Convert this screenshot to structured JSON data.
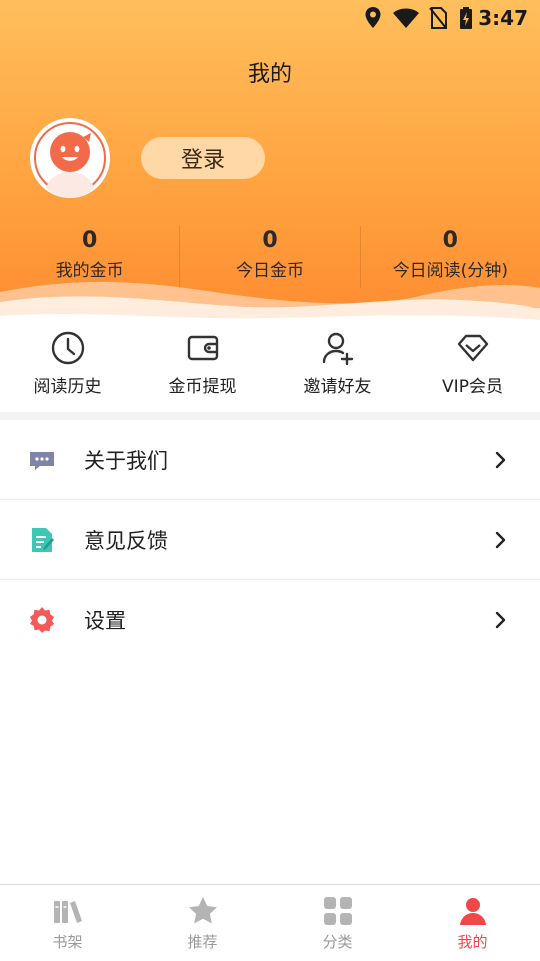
{
  "status": {
    "time": "3:47"
  },
  "page": {
    "title": "我的"
  },
  "profile": {
    "login_label": "登录"
  },
  "stats": [
    {
      "value": "0",
      "label": "我的金币"
    },
    {
      "value": "0",
      "label": "今日金币"
    },
    {
      "value": "0",
      "label": "今日阅读(分钟)"
    }
  ],
  "quick_actions": [
    {
      "label": "阅读历史",
      "icon": "clock-icon"
    },
    {
      "label": "金币提现",
      "icon": "wallet-icon"
    },
    {
      "label": "邀请好友",
      "icon": "add-user-icon"
    },
    {
      "label": "VIP会员",
      "icon": "diamond-icon"
    }
  ],
  "menu": [
    {
      "label": "关于我们",
      "icon": "chat-bubble-icon",
      "color": "#7e86a8"
    },
    {
      "label": "意见反馈",
      "icon": "feedback-icon",
      "color": "#3cc8b4"
    },
    {
      "label": "设置",
      "icon": "gear-icon",
      "color": "#f45a5a"
    }
  ],
  "tabs": [
    {
      "label": "书架",
      "icon": "bookshelf-icon",
      "active": false
    },
    {
      "label": "推荐",
      "icon": "star-icon",
      "active": false
    },
    {
      "label": "分类",
      "icon": "grid-icon",
      "active": false
    },
    {
      "label": "我的",
      "icon": "person-icon",
      "active": true
    }
  ],
  "colors": {
    "accent": "#f04848",
    "header_top": "#ffbf5c",
    "header_bottom": "#ff8a30"
  }
}
